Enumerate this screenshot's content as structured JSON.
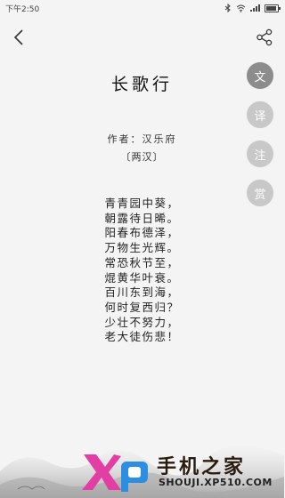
{
  "status": {
    "time": "下午2:50",
    "battery_level": 0.8
  },
  "poem": {
    "title": "长歌行",
    "author": "作者：汉乐府",
    "dynasty": "〔两汉〕",
    "lines": [
      "青青园中葵，",
      "朝露待日晞。",
      "阳春布德泽，",
      "万物生光辉。",
      "常恐秋节至，",
      "焜黄华叶衰。",
      "百川东到海，",
      "何时复西归？",
      "少壮不努力，",
      "老大徒伤悲！"
    ]
  },
  "side_tools": [
    {
      "label": "文",
      "icon": "text-icon",
      "active": true
    },
    {
      "label": "译",
      "icon": "translate-icon",
      "active": false
    },
    {
      "label": "注",
      "icon": "annotation-icon",
      "active": false
    },
    {
      "label": "赏",
      "icon": "appreciation-icon",
      "active": false
    }
  ],
  "watermark": {
    "text": "手机之家",
    "url": "SHOUJI.XP510.COM"
  }
}
